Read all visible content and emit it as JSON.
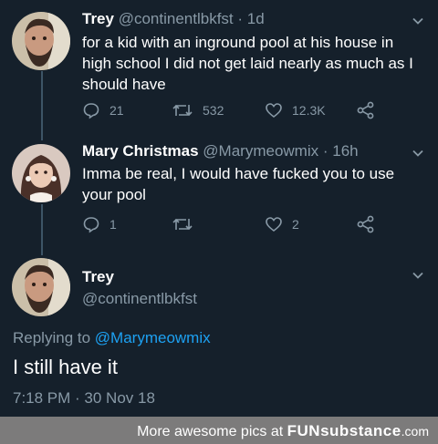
{
  "tweets": [
    {
      "name": "Trey",
      "handle": "@continentlbkfst",
      "separator": "·",
      "time": "1d",
      "text": "for a kid with an inground pool at his house in high school I did not get laid nearly as much as I should have",
      "replies": "21",
      "retweets": "532",
      "likes": "12.3K"
    },
    {
      "name": "Mary Christmas",
      "handle": "@Marymeowmix",
      "separator": "·",
      "time": "16h",
      "text": "Imma be real, I would have fucked you to use your pool",
      "replies": "1",
      "retweets": "",
      "likes": "2"
    }
  ],
  "main_tweet": {
    "name": "Trey",
    "handle": "@continentlbkfst",
    "replying_prefix": "Replying to",
    "replying_to": "@Marymeowmix",
    "text": "I still have it",
    "timestamp": "7:18 PM · 30 Nov 18"
  },
  "watermark": {
    "prefix": "More awesome pics at",
    "brand_fun": "FUN",
    "brand_substance": "substance",
    "suffix": ".com"
  },
  "colors": {
    "background": "#15202b",
    "secondary_text": "#8899a6",
    "mention": "#1da1f2",
    "thread_line": "#3d5466",
    "watermark_bar": "#7c7b7b"
  }
}
